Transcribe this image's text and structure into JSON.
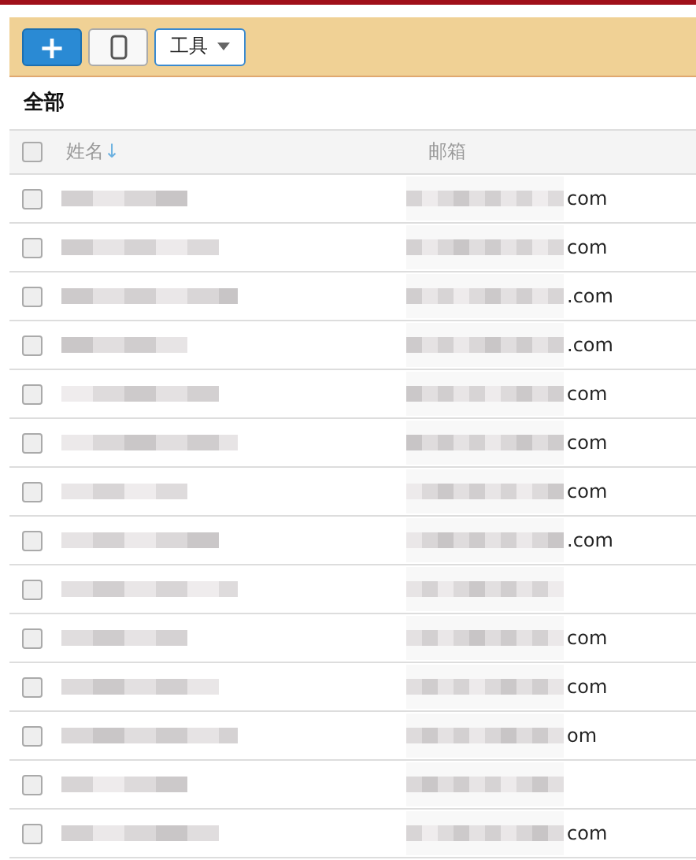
{
  "toolbar": {
    "buttons": [
      {
        "kind": "add",
        "label": "+"
      },
      {
        "kind": "mobile"
      },
      {
        "kind": "menu",
        "label": "工具"
      }
    ]
  },
  "section_title": "全部",
  "table": {
    "header": {
      "checked": false,
      "columns": [
        {
          "label": "姓名",
          "sort_indicator": "↓"
        },
        {
          "label": "邮箱"
        }
      ]
    },
    "rows": [
      {
        "checked": false,
        "email_suffix": "com"
      },
      {
        "checked": false,
        "email_suffix": "com"
      },
      {
        "checked": false,
        "email_suffix": ".com"
      },
      {
        "checked": false,
        "email_suffix": ".com"
      },
      {
        "checked": false,
        "email_suffix": "com"
      },
      {
        "checked": false,
        "email_suffix": "com"
      },
      {
        "checked": false,
        "email_suffix": "com"
      },
      {
        "checked": false,
        "email_suffix": ".com"
      },
      {
        "checked": false
      },
      {
        "checked": false,
        "email_suffix": "com"
      },
      {
        "checked": false,
        "email_suffix": "com"
      },
      {
        "checked": false,
        "email_suffix": "om"
      },
      {
        "checked": false
      },
      {
        "checked": false,
        "email_suffix": "com"
      }
    ]
  }
}
